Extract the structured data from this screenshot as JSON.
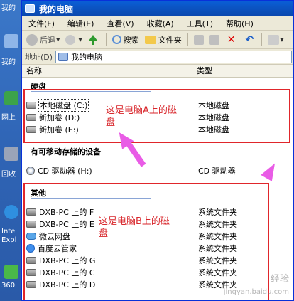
{
  "window": {
    "title": "我的电脑"
  },
  "menu": [
    "文件(F)",
    "编辑(E)",
    "查看(V)",
    "收藏(A)",
    "工具(T)",
    "帮助(H)"
  ],
  "toolbar": {
    "back_label": "后退",
    "search_label": "搜索",
    "folders_label": "文件夹"
  },
  "address": {
    "label": "地址(D)",
    "value": "我的电脑"
  },
  "columns": {
    "name": "名称",
    "type": "类型"
  },
  "groups": {
    "hard_disks": "硬盘",
    "removable": "有可移动存储的设备",
    "other": "其他"
  },
  "hard_disks": [
    {
      "name": "本地磁盘 (C:)",
      "type": "本地磁盘"
    },
    {
      "name": "新加卷 (D:)",
      "type": "本地磁盘"
    },
    {
      "name": "新加卷 (E:)",
      "type": "本地磁盘"
    }
  ],
  "removable": [
    {
      "name": "CD 驱动器 (H:)",
      "type": "CD 驱动器"
    }
  ],
  "other": [
    {
      "name": "DXB-PC 上的 F",
      "type": "系统文件夹"
    },
    {
      "name": "DXB-PC 上的 E",
      "type": "系统文件夹"
    },
    {
      "name": "微云网盘",
      "type": "系统文件夹"
    },
    {
      "name": "百度云管家",
      "type": "系统文件夹"
    },
    {
      "name": "DXB-PC 上的 G",
      "type": "系统文件夹"
    },
    {
      "name": "DXB-PC 上的 C",
      "type": "系统文件夹"
    },
    {
      "name": "DXB-PC 上的 D",
      "type": "系统文件夹"
    }
  ],
  "annotations": {
    "computer_a": [
      "这是电脑A上的磁",
      "盘"
    ],
    "computer_b": [
      "这是电脑B上的磁",
      "盘"
    ]
  },
  "desktop": {
    "labels": [
      "我的",
      "我的",
      "网上",
      "回收",
      "Inte",
      "Expl",
      "360"
    ]
  },
  "watermark": {
    "text": "经验",
    "url": "jingyan.baidu.com"
  },
  "colors": {
    "annotation_red": "#e0262b",
    "arrow_magenta": "#e95ce6",
    "titlebar_blue": "#0a5fd8"
  }
}
